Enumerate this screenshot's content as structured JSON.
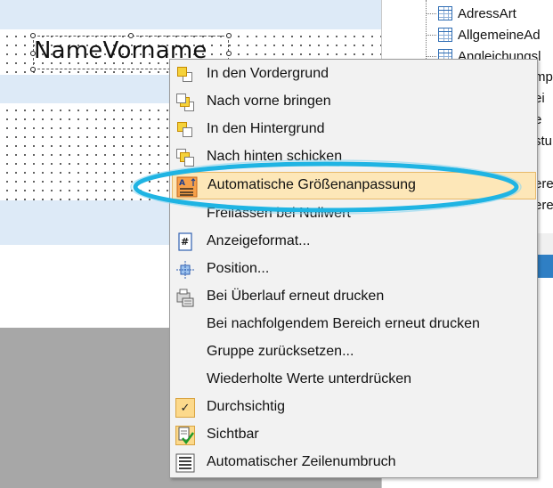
{
  "designer": {
    "field_label": "NameVorname"
  },
  "panel": {
    "tables": [
      "AdressArt",
      "AllgemeineAd",
      "Angleichungsl"
    ],
    "snippets": [
      "mp",
      "ei",
      "e",
      "stu",
      "ere",
      "ere"
    ]
  },
  "context_menu": {
    "items": [
      {
        "label": "In  den  Vordergrund",
        "icon": "bring-to-front-icon"
      },
      {
        "label": "Nach vorne bringen",
        "icon": "bring-forward-icon"
      },
      {
        "label": "In den Hintergrund",
        "icon": "send-to-back-icon"
      },
      {
        "label": "Nach hinten schicken",
        "icon": "send-backward-icon"
      },
      {
        "label": "Automatische Größenanpassung",
        "icon": "auto-size-icon"
      },
      {
        "label": "Freilassen bei Nullwert",
        "icon": ""
      },
      {
        "label": "Anzeigeformat...",
        "icon": "display-format-icon"
      },
      {
        "label": "Position...",
        "icon": "position-icon"
      },
      {
        "label": "Bei Überlauf erneut drucken",
        "icon": "reprint-icon"
      },
      {
        "label": "Bei nachfolgendem Bereich erneut drucken",
        "icon": ""
      },
      {
        "label": "Gruppe zurücksetzen...",
        "icon": ""
      },
      {
        "label": "Wiederholte Werte unterdrücken",
        "icon": ""
      },
      {
        "label": "Durchsichtig",
        "icon": "checkmark-icon"
      },
      {
        "label": "Sichtbar",
        "icon": "visible-check-icon"
      },
      {
        "label": "Automatischer Zeilenumbruch",
        "icon": "word-wrap-icon"
      }
    ],
    "highlighted_index": 4
  },
  "colors": {
    "highlight_bg": "#fde7b8",
    "annotation_ring": "#1fb4e3",
    "band_blue": "#ddeaf7"
  }
}
